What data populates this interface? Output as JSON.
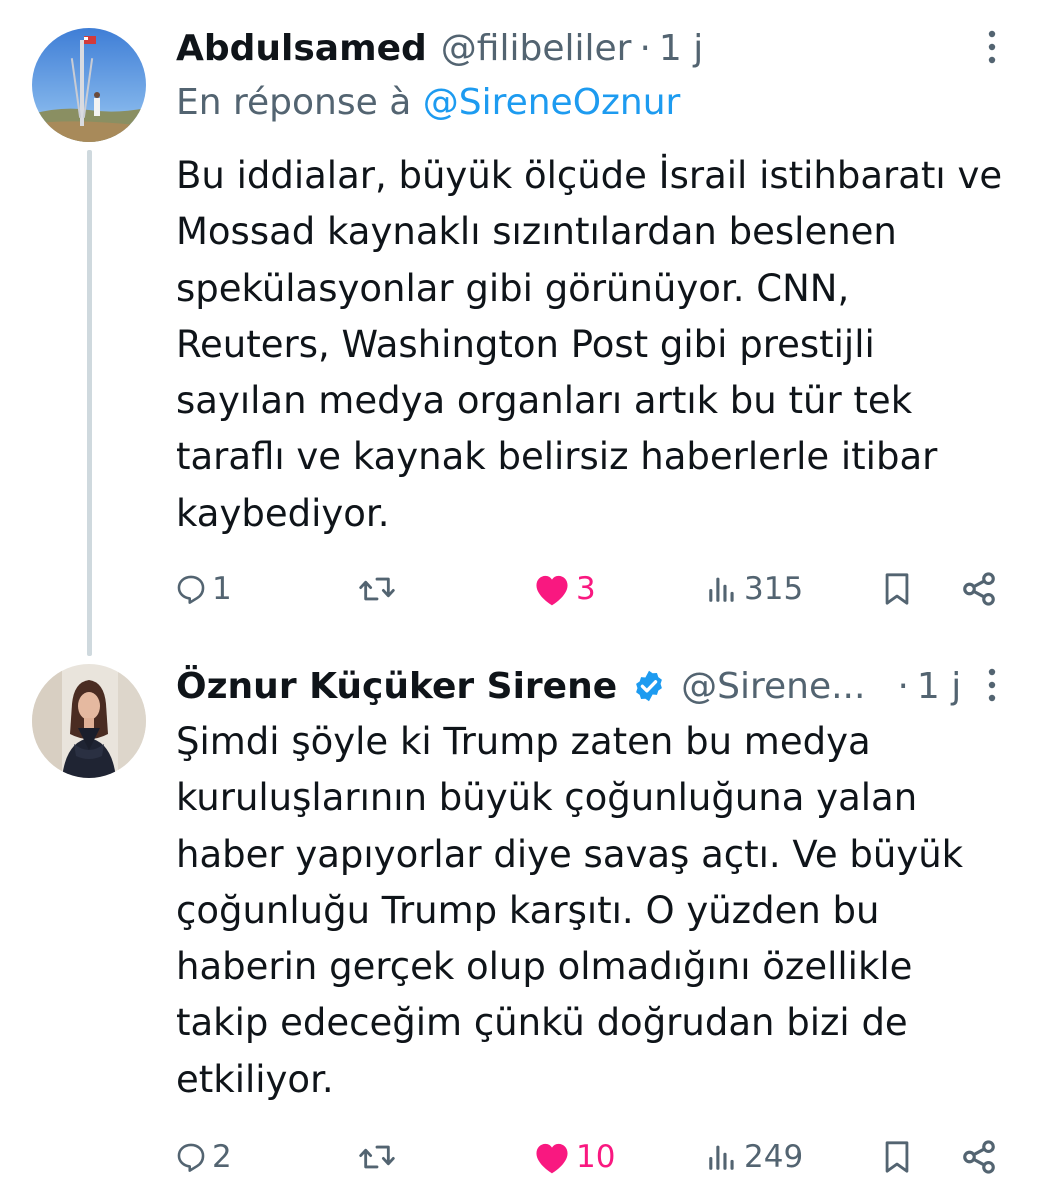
{
  "tweets": [
    {
      "name": "Abdulsamed",
      "handle": "@filibeliler",
      "separator": "·",
      "time": "1 j",
      "reply_prefix": "En réponse à",
      "reply_mention": "@SireneOznur",
      "text": "Bu iddialar, büyük ölçüde İsrail istihbaratı ve\nMossad kaynaklı sızıntılardan beslenen\nspekülasyonlar gibi görünüyor. CNN,\nReuters, Washington Post gibi prestijli\nsayılan medya organları artık bu tür tek\ntaraflı ve kaynak belirsiz haberlerle itibar\nkaybediyor.",
      "stats": {
        "replies": "1",
        "retweets": "",
        "likes": "3",
        "views": "315"
      },
      "liked": true,
      "verified": false
    },
    {
      "name": "Öznur Küçüker Sirene",
      "handle": "@Sirene...",
      "separator": "·",
      "time": "1 j",
      "text": "Şimdi şöyle ki Trump zaten bu medya\nkuruluşlarının büyük çoğunluğuna yalan\nhaber yapıyorlar diye savaş açtı. Ve büyük\nçoğunluğu Trump karşıtı. O yüzden bu\nhaberin gerçek olup olmadığını özellikle\ntakip edeceğim çünkü doğrudan bizi de\netkiliyor.",
      "stats": {
        "replies": "2",
        "retweets": "",
        "likes": "10",
        "views": "249"
      },
      "liked": true,
      "verified": true
    }
  ],
  "colors": {
    "text": "#0f1419",
    "secondary": "#536471",
    "link": "#1d9bf0",
    "like": "#f91880",
    "thread_line": "#cfd9de",
    "verified": "#1d9bf0"
  },
  "icons": [
    "more-icon",
    "reply-icon",
    "retweet-icon",
    "like-icon",
    "views-icon",
    "bookmark-icon",
    "share-icon",
    "verified-icon"
  ]
}
